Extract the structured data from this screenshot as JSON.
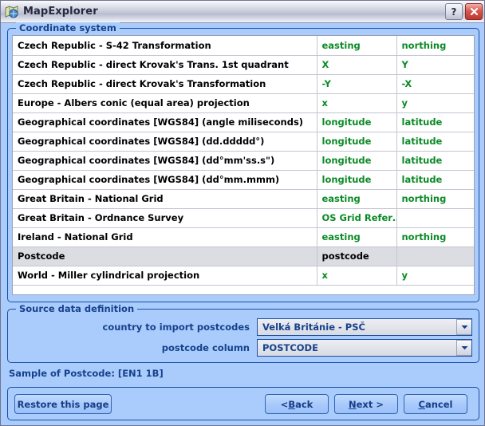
{
  "window": {
    "title": "MapExplorer",
    "icon": "map-explorer-icon",
    "help_label": "?",
    "close_label": "close-icon"
  },
  "coordinate_system": {
    "group_title": "Coordinate system",
    "rows": [
      {
        "name": "Czech Republic - S-42 Transformation",
        "x": "easting",
        "y": "northing",
        "selected": false
      },
      {
        "name": "Czech Republic - direct Krovak's Trans. 1st quadrant",
        "x": "X",
        "y": "Y",
        "selected": false
      },
      {
        "name": "Czech Republic - direct Krovak's Transformation",
        "x": "-Y",
        "y": "-X",
        "selected": false
      },
      {
        "name": "Europe - Albers conic (equal area) projection",
        "x": "x",
        "y": "y",
        "selected": false
      },
      {
        "name": "Geographical coordinates [WGS84] (angle miliseconds)",
        "x": "longitude",
        "y": "latitude",
        "selected": false
      },
      {
        "name": "Geographical coordinates [WGS84] (dd.ddddd°)",
        "x": "longitude",
        "y": "latitude",
        "selected": false
      },
      {
        "name": "Geographical coordinates [WGS84] (dd°mm'ss.s\")",
        "x": "longitude",
        "y": "latitude",
        "selected": false
      },
      {
        "name": "Geographical coordinates [WGS84] (dd°mm.mmm)",
        "x": "longitude",
        "y": "latitude",
        "selected": false
      },
      {
        "name": "Great Britain - National Grid",
        "x": "easting",
        "y": "northing",
        "selected": false
      },
      {
        "name": "Great Britain - Ordnance Survey",
        "x": "OS Grid Refer…",
        "y": "",
        "selected": false
      },
      {
        "name": "Ireland - National Grid",
        "x": "easting",
        "y": "northing",
        "selected": false
      },
      {
        "name": "Postcode",
        "x": "postcode",
        "y": "",
        "selected": true
      },
      {
        "name": "World - Miller cylindrical projection",
        "x": "x",
        "y": "y",
        "selected": false
      }
    ]
  },
  "source_data": {
    "group_title": "Source data definition",
    "country_label": "country to import postcodes",
    "country_value": "Velká Británie  - PSČ",
    "column_label": "postcode column",
    "column_value": "POSTCODE"
  },
  "sample": {
    "text": "Sample of Postcode: [EN1 1B]"
  },
  "buttons": {
    "restore": "Restore this page",
    "back_prefix": "< ",
    "back_mnemonic": "B",
    "back_suffix": "ack",
    "next_prefix": "",
    "next_mnemonic": "N",
    "next_suffix": "ext >",
    "cancel_mnemonic": "C",
    "cancel_suffix": "ancel"
  },
  "colors": {
    "window_background": "#aaccfc",
    "accent_blue": "#16418c",
    "value_green": "#0b8a26",
    "selection_gray": "#dcdde2",
    "close_red": "#d9584f"
  }
}
